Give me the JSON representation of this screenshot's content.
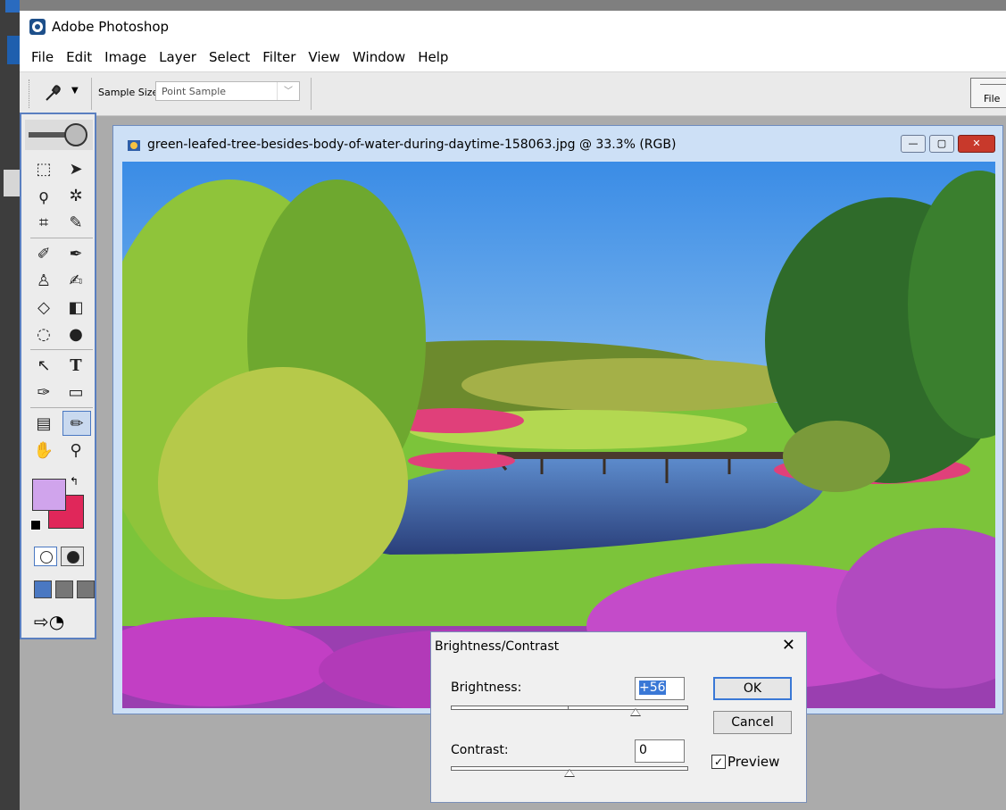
{
  "app": {
    "title": "Adobe Photoshop",
    "icon": "photoshop-app-icon"
  },
  "menu": [
    "File",
    "Edit",
    "Image",
    "Layer",
    "Select",
    "Filter",
    "View",
    "Window",
    "Help"
  ],
  "options_bar": {
    "tool_icon": "eyedropper-icon",
    "sample_size_label": "Sample Size:",
    "sample_size_value": "Point Sample",
    "file_browser_label": "File"
  },
  "document": {
    "title": "green-leafed-tree-besides-body-of-water-during-daytime-158063.jpg @ 33.3% (RGB)",
    "buttons": [
      "minimize",
      "maximize",
      "close"
    ]
  },
  "toolbox": {
    "foreground_color": "#d0a4ec",
    "background_color": "#e0275a"
  },
  "dialog": {
    "title": "Brightness/Contrast",
    "brightness_label": "Brightness:",
    "brightness_value": "+56",
    "contrast_label": "Contrast:",
    "contrast_value": "0",
    "ok_label": "OK",
    "cancel_label": "Cancel",
    "preview_label": "Preview",
    "preview_checked": true
  }
}
